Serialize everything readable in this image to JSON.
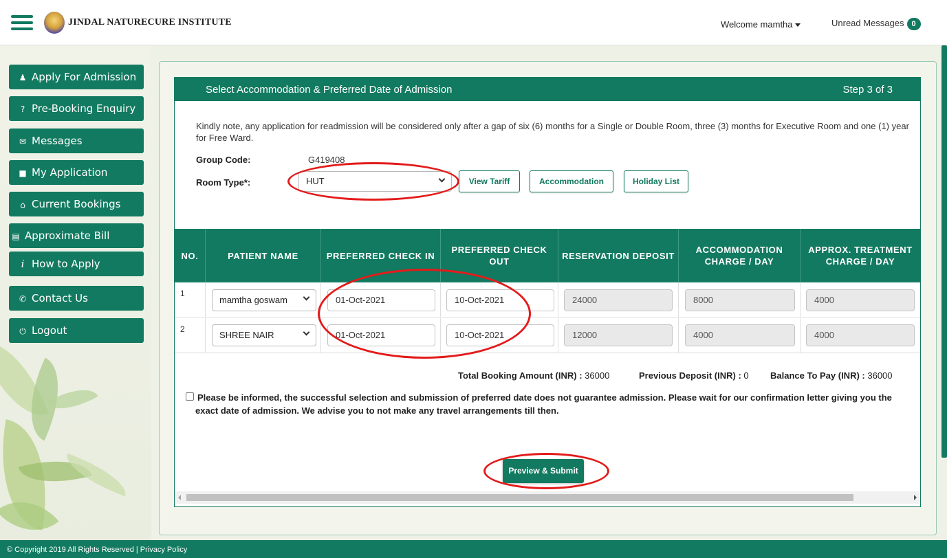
{
  "header": {
    "brand": "JINDAL NATURECURE INSTITUTE",
    "welcome": "Welcome mamtha",
    "unread_label": "Unread Messages",
    "unread_count": "0"
  },
  "sidebar": {
    "items": [
      {
        "label": "Apply For Admission",
        "icon": "user-icon"
      },
      {
        "label": "Pre-Booking Enquiry",
        "icon": "question-icon"
      },
      {
        "label": "Messages",
        "icon": "message-icon"
      },
      {
        "label": "My Application",
        "icon": "document-icon"
      },
      {
        "label": "Current Bookings",
        "icon": "home-icon"
      },
      {
        "label": "Approximate Bill",
        "icon": "bill-icon"
      },
      {
        "label": "How to Apply",
        "icon": "info-icon"
      },
      {
        "label": "Contact Us",
        "icon": "phone-icon"
      },
      {
        "label": "Logout",
        "icon": "power-icon"
      }
    ]
  },
  "card": {
    "title": "Select Accommodation & Preferred Date of Admission",
    "step": "Step 3 of 3",
    "note": "Kindly note, any application for readmission will be considered only after a gap of six (6) months for a Single or Double Room, three (3) months for Executive Room and one (1) year for Free Ward.",
    "group_code_label": "Group Code:",
    "group_code": "G419408",
    "room_type_label": "Room Type*:",
    "room_type": "HUT",
    "buttons": {
      "tariff": "View Tariff",
      "accommodation": "Accommodation",
      "holiday": "Holiday List"
    }
  },
  "table": {
    "headers": [
      "NO.",
      "PATIENT NAME",
      "PREFERRED CHECK IN",
      "PREFERRED CHECK OUT",
      "RESERVATION DEPOSIT",
      "ACCOMMODATION CHARGE / DAY",
      "APPROX. TREATMENT CHARGE / DAY"
    ],
    "rows": [
      {
        "no": "1",
        "patient": "mamtha goswam",
        "check_in": "01-Oct-2021",
        "check_out": "10-Oct-2021",
        "deposit": "24000",
        "accommodation": "8000",
        "treatment": "4000"
      },
      {
        "no": "2",
        "patient": "SHREE NAIR",
        "check_in": "01-Oct-2021",
        "check_out": "10-Oct-2021",
        "deposit": "12000",
        "accommodation": "4000",
        "treatment": "4000"
      }
    ]
  },
  "totals": {
    "booking_label": "Total Booking Amount (INR) :",
    "booking": "36000",
    "previous_label": "Previous Deposit (INR) :",
    "previous": "0",
    "balance_label": "Balance To Pay (INR) :",
    "balance": "36000"
  },
  "disclaimer": "Please be informed, the successful selection and submission of preferred date does not guarantee admission. Please wait for our confirmation letter giving you the exact date of admission. We advise you to not make any travel arrangements till then.",
  "submit_label": "Preview & Submit",
  "footer": {
    "copyright": "© Copyright 2019 All Rights Reserved | Privacy Policy"
  },
  "colors": {
    "brand_green": "#127a60",
    "annotation_red": "#e31b1b"
  }
}
